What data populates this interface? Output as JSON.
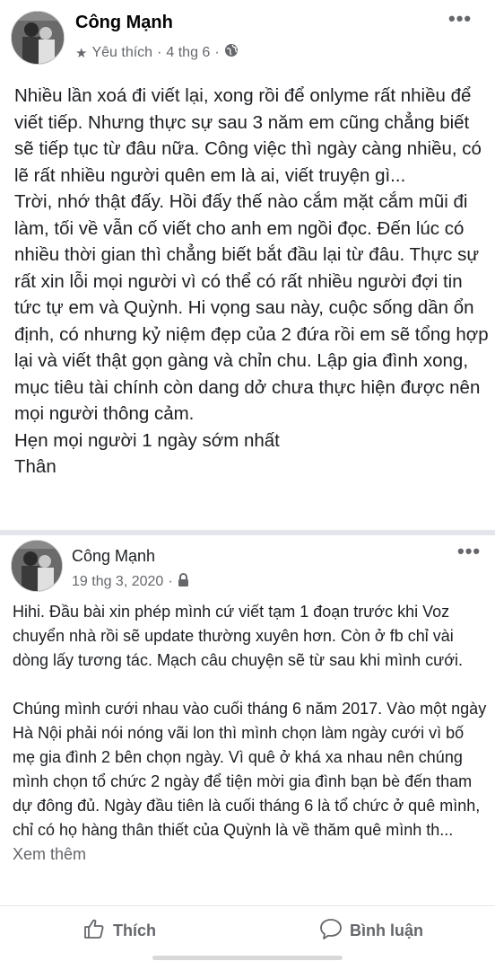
{
  "post1": {
    "author": "Công Mạnh",
    "favorite_label": "Yêu thích",
    "sep1": "·",
    "date": "4 thg 6",
    "sep2": "·",
    "more": "•••",
    "paragraphs": [
      "Nhiều lần xoá đi viết lại, xong rồi để onlyme rất nhiều để viết tiếp. Nhưng thực sự sau 3 năm em cũng chẳng biết sẽ tiếp tục từ đâu nữa. Công việc thì ngày càng nhiều, có lẽ rất nhiều người quên em là ai, viết truyện gì...",
      "Trời, nhớ thật đấy. Hồi đấy thế nào cắm mặt cắm mũi đi làm, tối về vẫn cố viết cho anh em ngồi đọc. Đến lúc có nhiều thời gian thì chẳng biết bắt đầu lại từ đâu. Thực sự rất xin lỗi mọi người vì có thể có rất nhiều người đợi tin tức tự em và Quỳnh. Hi vọng sau này, cuộc sống dần ổn định, có nhưng kỷ niệm đẹp của 2 đứa rồi em sẽ tổng hợp lại và viết thật gọn gàng và chỉn chu. Lập gia đình xong, mục tiêu tài chính còn dang dở chưa thực hiện được nên mọi người thông cảm.",
      "Hẹn mọi người 1 ngày sớm nhất",
      "Thân"
    ]
  },
  "post2": {
    "author": "Công Mạnh",
    "date": "19 thg 3, 2020",
    "sep": "·",
    "more": "•••",
    "paragraph1": "Hihi. Đầu bài xin phép mình cứ viết tạm 1 đoạn trước khi Voz chuyển nhà rồi sẽ update thường xuyên hơn. Còn ở fb chỉ vài dòng lấy tương tác. Mạch câu chuyện sẽ từ sau khi mình cưới.",
    "paragraph2": "Chúng mình cưới nhau vào cuối tháng 6 năm 2017. Vào một ngày Hà Nội phải nói nóng vãi lon thì mình chọn làm ngày cưới vì bố mẹ gia đình 2 bên chọn ngày. Vì quê ở khá xa nhau nên chúng mình chọn tổ chức 2 ngày để tiện mời gia đình bạn bè đến tham dự đông đủ. Ngày đầu tiên là cuối tháng 6 là tổ chức ở quê mình, chỉ có họ hàng thân thiết của Quỳnh là về thăm quê mình th...",
    "see_more": "Xem thêm"
  },
  "actions": {
    "like_label": "Thích",
    "comment_label": "Bình luận"
  },
  "icons": {
    "star": "star-icon",
    "globe": "globe-icon",
    "lock": "lock-icon",
    "like": "thumbs-up-icon",
    "comment": "comment-bubble-icon"
  },
  "colors": {
    "text": "#1c1e21",
    "secondary": "#65676b",
    "divider": "#e4e6eb"
  }
}
